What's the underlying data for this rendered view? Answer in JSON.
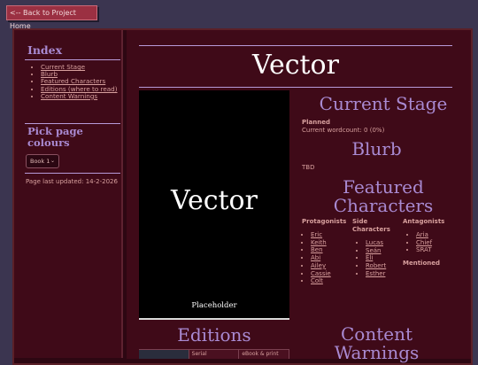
{
  "back_button": {
    "label": "<-- Back to Project Home"
  },
  "sidebar": {
    "index_title": "Index",
    "index_items": [
      "Current Stage",
      "Blurb",
      "Featured Characters",
      "Editions (where to read)",
      "Content Warnings"
    ],
    "colours_title": "Pick page colours",
    "colour_select": {
      "selected": "Book 1"
    },
    "updated": "Page last updated: 14-2-2026"
  },
  "main": {
    "title": "Vector",
    "cover": {
      "title": "Vector",
      "caption": "Placeholder"
    },
    "current_stage": {
      "heading": "Current Stage",
      "status": "Planned",
      "wordcount": "Current wordcount: 0 (0%)"
    },
    "blurb": {
      "heading": "Blurb",
      "text": "TBD"
    },
    "featured_characters": {
      "heading_line1": "Featured",
      "heading_line2": "Characters",
      "protagonists": {
        "label": "Protagonists",
        "names": [
          "Eric",
          "Keith",
          "Ben",
          "Abi",
          "Ailey",
          "Cassie",
          "Colt"
        ]
      },
      "side_characters": {
        "label_line1": "Side",
        "label_line2": "Characters",
        "names": [
          "Lucas",
          "Seán",
          "Eli",
          "Robert",
          "Esther"
        ]
      },
      "antagonists": {
        "label": "Antagonists",
        "names": [
          "Aria",
          "Chief",
          "SRAT"
        ]
      },
      "mentioned": {
        "label": "Mentioned"
      }
    },
    "editions": {
      "heading": "Editions",
      "table_headers": [
        "",
        "Serial",
        "eBook & print"
      ]
    },
    "content_warnings": {
      "heading_line1": "Content",
      "heading_line2": "Warnings"
    }
  },
  "colors": {
    "background": "#3b3550",
    "panel": "#3f0a18",
    "accent": "#a98ad2",
    "text": "#d8a09e",
    "back_button": "#9b3042"
  }
}
